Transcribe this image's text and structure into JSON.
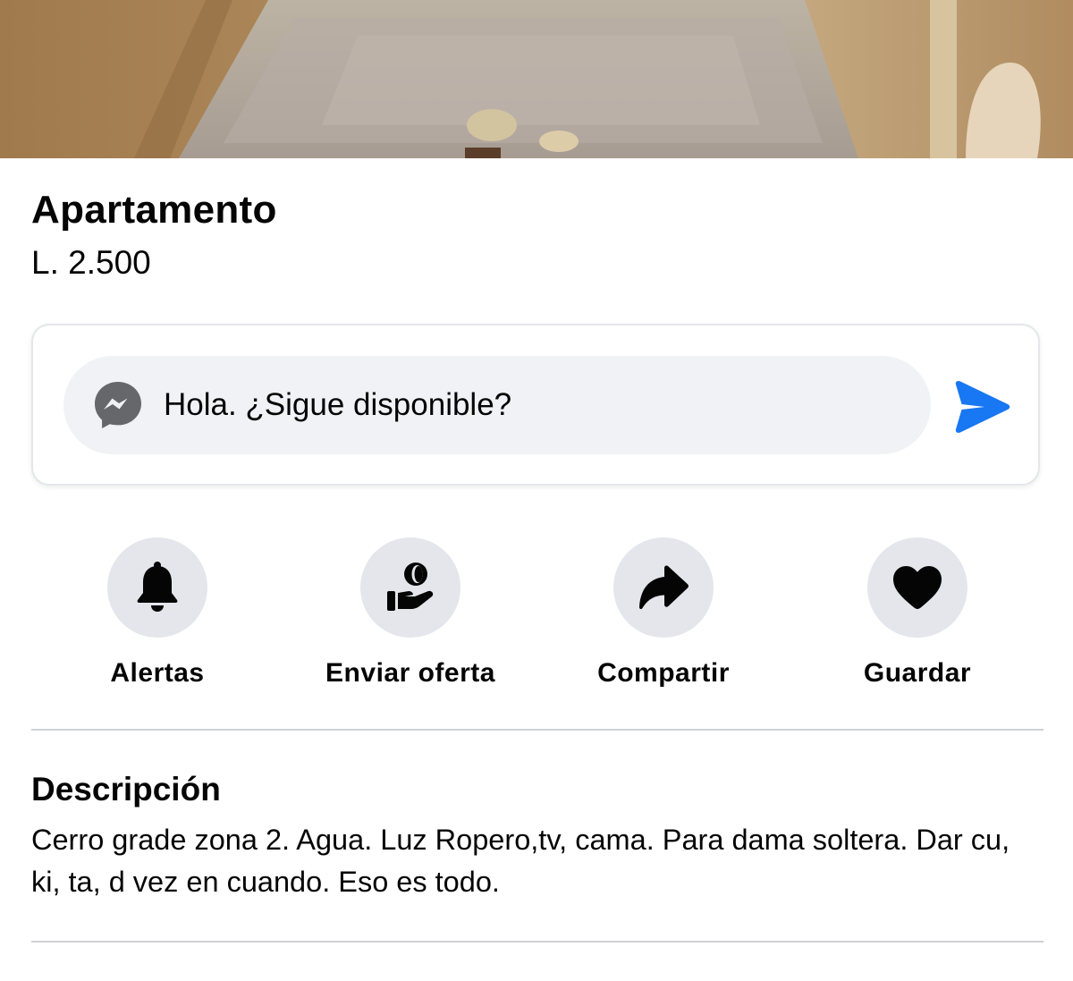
{
  "listing": {
    "title": "Apartamento",
    "price": "L. 2.500"
  },
  "message": {
    "text": "Hola. ¿Sigue disponible?",
    "icon": "messenger-icon",
    "send_icon": "send-icon"
  },
  "actions": [
    {
      "label": "Alertas",
      "icon": "bell-icon"
    },
    {
      "label": "Enviar oferta",
      "icon": "offer-icon"
    },
    {
      "label": "Compartir",
      "icon": "share-icon"
    },
    {
      "label": "Guardar",
      "icon": "heart-icon"
    }
  ],
  "description": {
    "heading": "Descripción",
    "body": "Cerro grade zona 2. Agua. Luz Ropero,tv, cama. Para dama soltera. Dar cu, ki, ta, d vez en cuando. Eso es todo."
  },
  "colors": {
    "accent": "#1877f2",
    "icon_circle": "#e4e6eb",
    "input_bg": "#f0f2f5",
    "text": "#050505"
  }
}
